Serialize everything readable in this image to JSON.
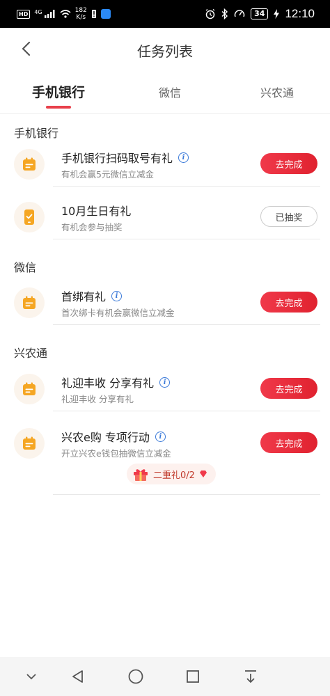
{
  "status_bar": {
    "hd": "HD",
    "network": "4G",
    "speed_value": "182",
    "speed_unit": "K/s",
    "battery": "34",
    "time": "12:10"
  },
  "header": {
    "title": "任务列表"
  },
  "tabs": [
    {
      "label": "手机银行",
      "active": true
    },
    {
      "label": "微信",
      "active": false
    },
    {
      "label": "兴农通",
      "active": false
    }
  ],
  "sections": [
    {
      "title": "手机银行",
      "tasks": [
        {
          "title": "手机银行扫码取号有礼",
          "subtitle": "有机会赢5元微信立减金",
          "button": "去完成",
          "icon": "calendar-icon",
          "info": true
        },
        {
          "title": "10月生日有礼",
          "subtitle": "有机会参与抽奖",
          "button": "已抽奖",
          "icon": "phone-check-icon",
          "info": false
        }
      ]
    },
    {
      "title": "微信",
      "tasks": [
        {
          "title": "首绑有礼",
          "subtitle": "首次绑卡有机会赢微信立减金",
          "button": "去完成",
          "icon": "calendar-icon",
          "info": true
        }
      ]
    },
    {
      "title": "兴农通",
      "tasks": [
        {
          "title": "礼迎丰收 分享有礼",
          "subtitle": "礼迎丰收 分享有礼",
          "button": "去完成",
          "icon": "calendar-icon",
          "info": true
        },
        {
          "title": "兴农e购 专项行动",
          "subtitle": "开立兴农e钱包抽微信立减金",
          "button": "去完成",
          "icon": "calendar-icon",
          "info": true
        }
      ]
    }
  ],
  "bonus": {
    "label": "二重礼0/2"
  },
  "colors": {
    "accent": "#e8404b",
    "icon_orange": "#f5a623",
    "info_blue": "#3b7ad9"
  }
}
